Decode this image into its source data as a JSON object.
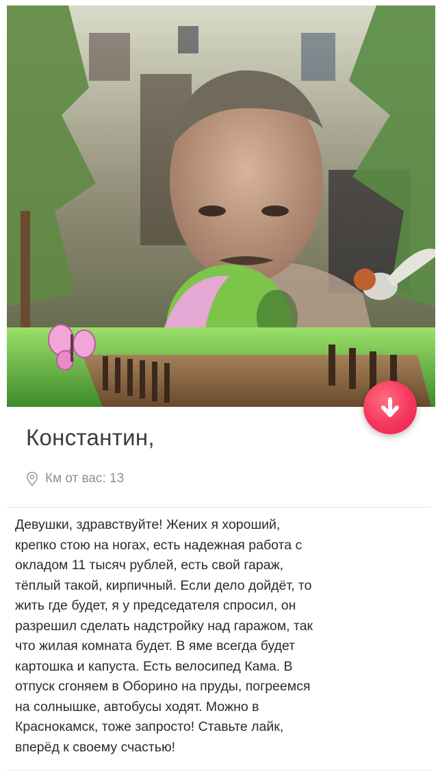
{
  "profile": {
    "name": "Константин,",
    "distance_label": "Км от вас: 13",
    "bio": "Девушки, здравствуйте! Жених я хороший,\nкрепко стою на ногах, есть надежная работа с\nокладом 11 тысяч рублей, есть свой гараж,\nтёплый такой, кирпичный. Если дело дойдёт, то\nжить где будет, я у председателя спросил, он\nразрешил сделать надстройку над гаражом, так\nчто жилая комната будет. В яме всегда будет\nкартошка и капуста. Есть велосипед Кама. В\nотпуск сгоняем в Оборино на пруды, погреемся\nна солнышке, автобусы ходят. Можно в\nКраснокамск, тоже запросто! Ставьте лайк,\nвперёд к своему счастью!"
  },
  "icons": {
    "location": "location-pin-icon",
    "dislike": "arrow-down-icon"
  },
  "colors": {
    "accent": "#f5365c",
    "name_text": "#3c3c3c",
    "meta_text": "#8f8f8f"
  }
}
